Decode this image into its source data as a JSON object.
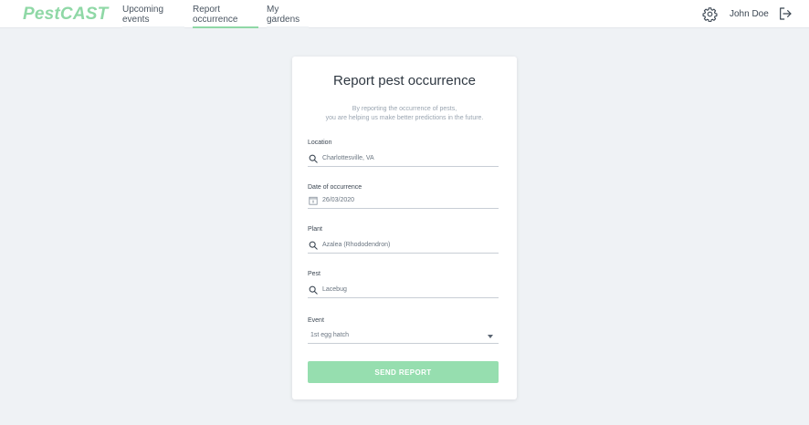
{
  "app": {
    "logo": "PestCAST"
  },
  "nav": {
    "items": [
      {
        "label": "Upcoming events",
        "active": false
      },
      {
        "label": "Report occurrence",
        "active": true
      },
      {
        "label": "My gardens",
        "active": false
      }
    ]
  },
  "user": {
    "name": "John Doe"
  },
  "icons": {
    "settings": "gear-icon",
    "logout": "logout-icon",
    "search": "search-icon",
    "calendar": "calendar-icon",
    "dropdown": "caret-down-icon"
  },
  "colors": {
    "brand": "#8fd8a6",
    "button": "#96deaf",
    "background": "#eff2f5"
  },
  "form": {
    "title": "Report pest occurrence",
    "subtitle_line1": "By reporting the occurrence of pests,",
    "subtitle_line2": "you are helping us make better predictions in the future.",
    "location": {
      "label": "Location",
      "value": "Charlottesville, VA"
    },
    "date": {
      "label": "Date of occurrence",
      "value": "26/03/2020"
    },
    "plant": {
      "label": "Plant",
      "value": "Azalea (Rhododendron)"
    },
    "pest": {
      "label": "Pest",
      "value": "Lacebug"
    },
    "event": {
      "label": "Event",
      "value": "1st egg hatch"
    },
    "submit_label": "SEND REPORT"
  }
}
